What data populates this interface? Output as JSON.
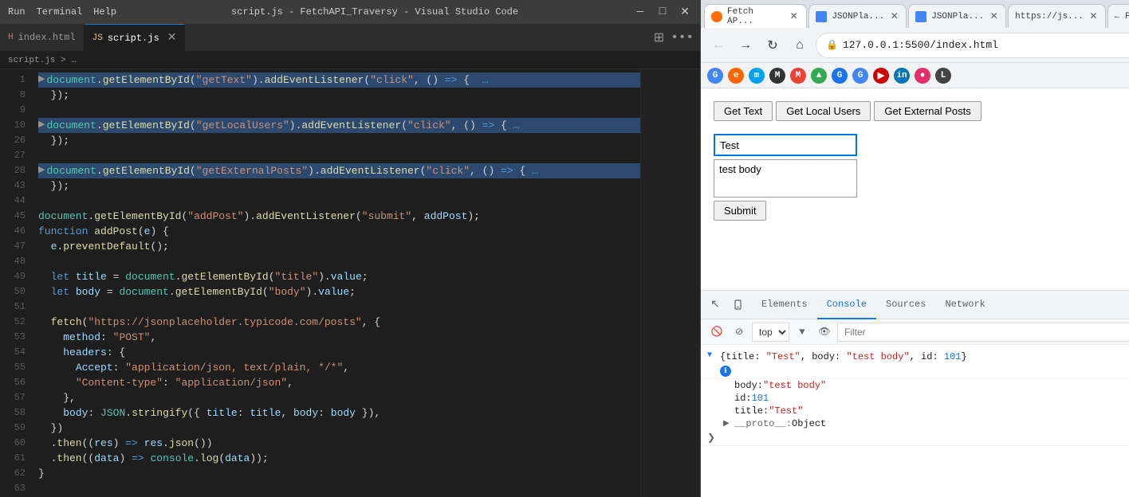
{
  "titlebar": {
    "menu_items": [
      "Run",
      "Terminal",
      "Help"
    ],
    "title": "script.js - FetchAPI_Traversy - Visual Studio Code",
    "controls": [
      "—",
      "□",
      "✕"
    ]
  },
  "tabs": [
    {
      "id": "index-html",
      "icon": "html",
      "label": "index.html",
      "closable": false,
      "active": false
    },
    {
      "id": "script-js",
      "icon": "js",
      "label": "script.js",
      "closable": true,
      "active": true
    }
  ],
  "breadcrumb": "script.js > …",
  "code_lines": [
    {
      "num": "1",
      "content": "document.getElementById(\"getText\").addEventListener(\"click\", () => {  …",
      "highlighted": true
    },
    {
      "num": "8",
      "content": "  });"
    },
    {
      "num": "9",
      "content": ""
    },
    {
      "num": "10",
      "content": "document.getElementById(\"getLocalUsers\").addEventListener(\"click\", () => { …",
      "highlighted": true
    },
    {
      "num": "26",
      "content": "  });"
    },
    {
      "num": "27",
      "content": ""
    },
    {
      "num": "28",
      "content": "document.getElementById(\"getExternalPosts\").addEventListener(\"click\", () => { …",
      "highlighted": true
    },
    {
      "num": "43",
      "content": "  });"
    },
    {
      "num": "44",
      "content": ""
    },
    {
      "num": "45",
      "content": "document.getElementById(\"addPost\").addEventListener(\"submit\", addPost);"
    },
    {
      "num": "46",
      "content": "function addPost(e) {"
    },
    {
      "num": "47",
      "content": "  e.preventDefault();"
    },
    {
      "num": "48",
      "content": ""
    },
    {
      "num": "49",
      "content": "  let title = document.getElementById(\"title\").value;"
    },
    {
      "num": "50",
      "content": "  let body = document.getElementById(\"body\").value;"
    },
    {
      "num": "51",
      "content": ""
    },
    {
      "num": "52",
      "content": "  fetch(\"https://jsonplaceholder.typicode.com/posts\", {"
    },
    {
      "num": "53",
      "content": "    method: \"POST\","
    },
    {
      "num": "54",
      "content": "    headers: {"
    },
    {
      "num": "55",
      "content": "      Accept: \"application/json, text/plain, */*\","
    },
    {
      "num": "56",
      "content": "      \"Content-type\": \"application/json\","
    },
    {
      "num": "57",
      "content": "    },"
    },
    {
      "num": "58",
      "content": "    body: JSON.stringify({ title: title, body: body }),"
    },
    {
      "num": "59",
      "content": "  })"
    },
    {
      "num": "60",
      "content": "  .then((res) => res.json())"
    },
    {
      "num": "61",
      "content": "  .then((data) => console.log(data));"
    },
    {
      "num": "62",
      "content": "}"
    },
    {
      "num": "63",
      "content": ""
    }
  ],
  "browser": {
    "tabs": [
      {
        "id": "fetch-api",
        "label": "Fetch AP...",
        "icon_type": "orange",
        "active": true
      },
      {
        "id": "json-1",
        "label": "JSONPla...",
        "icon_type": "blue",
        "active": false
      },
      {
        "id": "json-2",
        "label": "JSONPla...",
        "icon_type": "blue",
        "active": false
      },
      {
        "id": "https-js",
        "label": "https://js...",
        "icon_type": "gray",
        "active": false
      },
      {
        "id": "fetch-arrow",
        "label": "← Fetch A...",
        "icon_type": "arrow",
        "active": false
      }
    ],
    "address": "127.0.0.1:5500/index.html",
    "buttons": {
      "get_text": "Get Text",
      "get_local_users": "Get Local Users",
      "get_external_posts": "Get External Posts"
    },
    "form": {
      "title_value": "Test",
      "body_value": "test body",
      "submit_label": "Submit"
    },
    "devtools": {
      "tabs": [
        "Elements",
        "Console",
        "Sources",
        "Network"
      ],
      "active_tab": "Console",
      "toolbar": {
        "top_select": "top",
        "filter_placeholder": "Filter"
      },
      "console_entries": [
        {
          "type": "object",
          "expanded": true,
          "main_text": "{title: \"Test\", body: \"test body\", id: 101}",
          "children": [
            {
              "label": "body:",
              "value": "\"test body\""
            },
            {
              "label": "id:",
              "value": "101"
            },
            {
              "label": "title:",
              "value": "\"Test\""
            },
            {
              "label": "▶ __proto__:",
              "value": "Object",
              "expandable": true
            }
          ]
        },
        {
          "type": "prompt",
          "text": ""
        }
      ]
    }
  },
  "icons": {
    "back": "←",
    "forward": "→",
    "reload": "↻",
    "home": "⌂",
    "lock": "🔒",
    "search": "⊕",
    "cursor_tool": "↖",
    "device_tool": "□",
    "stop_tool": "⊘",
    "expand_triangle": "▶",
    "collapse_triangle": "▼"
  }
}
